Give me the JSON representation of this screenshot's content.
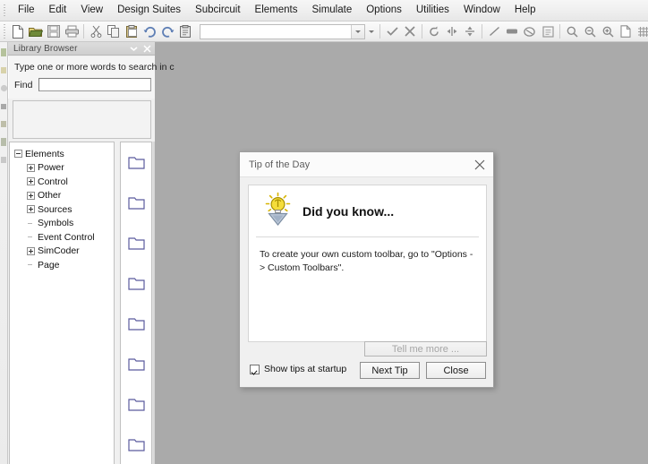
{
  "menu": {
    "items": [
      {
        "label": "File"
      },
      {
        "label": "Edit"
      },
      {
        "label": "View"
      },
      {
        "label": "Design Suites"
      },
      {
        "label": "Subcircuit"
      },
      {
        "label": "Elements"
      },
      {
        "label": "Simulate"
      },
      {
        "label": "Options"
      },
      {
        "label": "Utilities"
      },
      {
        "label": "Window"
      },
      {
        "label": "Help"
      }
    ]
  },
  "toolbar": {
    "left_icons": [
      {
        "name": "new-file-icon"
      },
      {
        "name": "open-folder-icon"
      },
      {
        "name": "save-icon"
      },
      {
        "name": "print-icon"
      },
      {
        "name": "cut-icon"
      },
      {
        "name": "copy-icon"
      },
      {
        "name": "paste-icon"
      },
      {
        "name": "undo-icon"
      },
      {
        "name": "redo-icon"
      },
      {
        "name": "clipboard-icon"
      }
    ],
    "combo_value": "",
    "right_icons": [
      {
        "name": "check-icon"
      },
      {
        "name": "cross-icon"
      },
      {
        "name": "rotate-icon"
      },
      {
        "name": "flip-horizontal-icon"
      },
      {
        "name": "flip-vertical-icon"
      },
      {
        "name": "line-icon"
      },
      {
        "name": "rectangle-icon"
      },
      {
        "name": "edit-shape-icon"
      },
      {
        "name": "label-icon"
      },
      {
        "name": "zoom-icon"
      },
      {
        "name": "zoom-out-icon"
      },
      {
        "name": "zoom-in-icon"
      },
      {
        "name": "page-icon"
      },
      {
        "name": "grid-icon"
      },
      {
        "name": "snap-grid-icon"
      },
      {
        "name": "stop-icon"
      },
      {
        "name": "record-icon"
      },
      {
        "name": "run-icon"
      },
      {
        "name": "pause-icon"
      }
    ]
  },
  "library_browser": {
    "title": "Library Browser",
    "search_hint": "Type one or more words to search in c",
    "find_label": "Find",
    "find_value": "",
    "find_placeholder": "",
    "tree": [
      {
        "label": "Elements",
        "indent": 0,
        "state": "expanded"
      },
      {
        "label": "Power",
        "indent": 1,
        "state": "collapsed"
      },
      {
        "label": "Control",
        "indent": 1,
        "state": "collapsed"
      },
      {
        "label": "Other",
        "indent": 1,
        "state": "collapsed"
      },
      {
        "label": "Sources",
        "indent": 1,
        "state": "collapsed"
      },
      {
        "label": "Symbols",
        "indent": 1,
        "state": "leaf"
      },
      {
        "label": "Event Control",
        "indent": 1,
        "state": "leaf"
      },
      {
        "label": "SimCoder",
        "indent": 1,
        "state": "collapsed"
      },
      {
        "label": "Page",
        "indent": 1,
        "state": "leaf"
      }
    ],
    "folder_count": 8
  },
  "dialog": {
    "title": "Tip of the Day",
    "heading": "Did you know...",
    "tip_text": "To create your own custom toolbar, go to \"Options -> Custom Toolbars\".",
    "tell_me_more_label": "Tell me more ...",
    "next_tip_label": "Next Tip",
    "close_label": "Close",
    "show_tips_label": "Show tips at startup",
    "show_tips_checked": true,
    "bulb_icon": "lightbulb-icon"
  },
  "colors": {
    "canvas": "#aaaaaa",
    "bulb_yellow": "#f2d62a",
    "folder_outline": "#5b5b9e"
  }
}
